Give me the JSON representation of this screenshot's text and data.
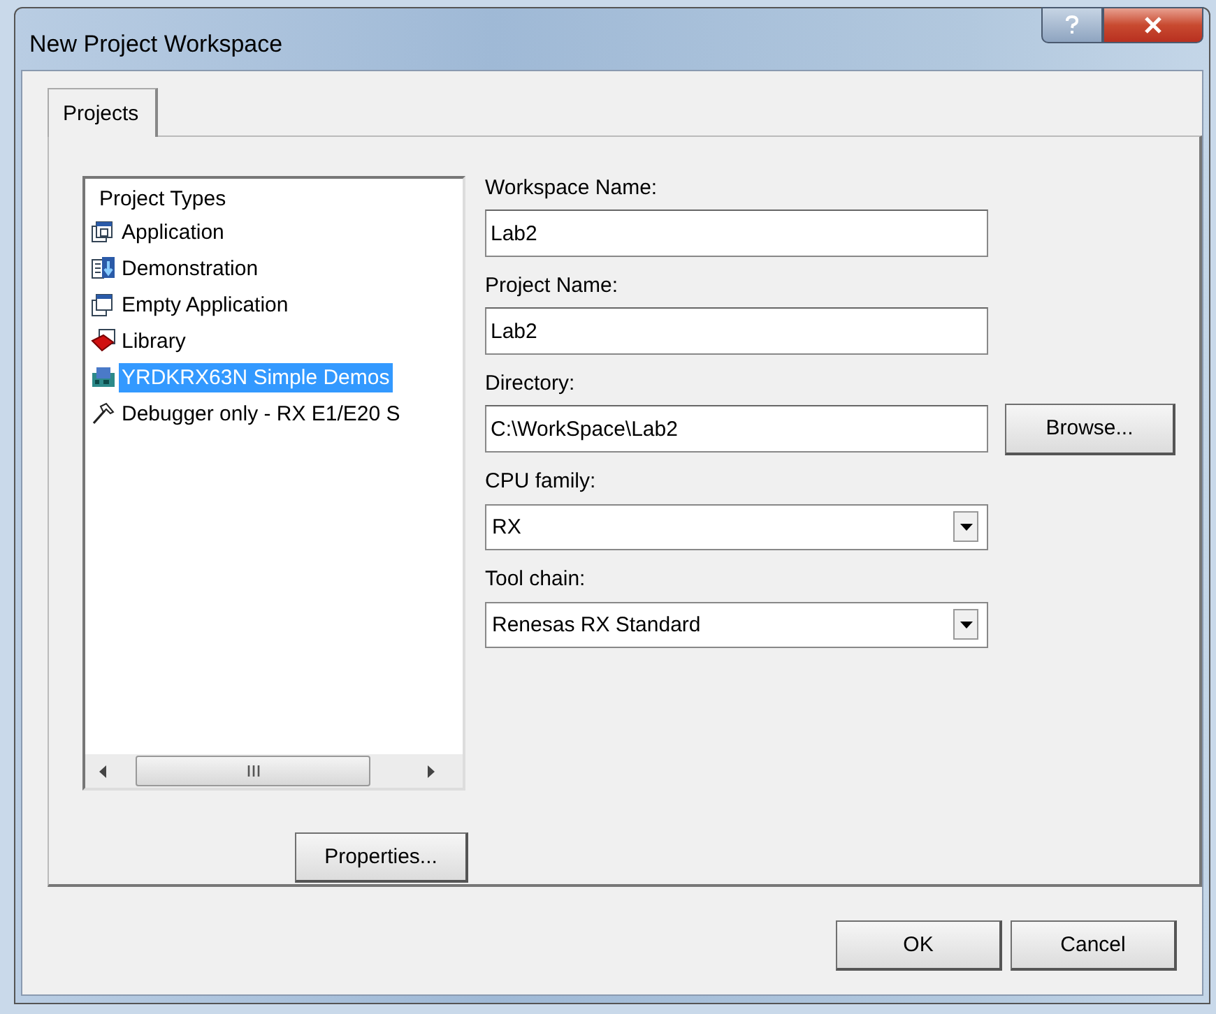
{
  "window": {
    "title": "New Project Workspace"
  },
  "tabs": [
    {
      "label": "Projects",
      "selected": true
    }
  ],
  "project_types": {
    "header": "Project Types",
    "items": [
      {
        "label": "Application",
        "selected": false
      },
      {
        "label": "Demonstration",
        "selected": false
      },
      {
        "label": "Empty Application",
        "selected": false
      },
      {
        "label": "Library",
        "selected": false
      },
      {
        "label": "YRDKRX63N Simple Demos",
        "selected": true
      },
      {
        "label": "Debugger only - RX E1/E20 S",
        "selected": false
      }
    ]
  },
  "properties_button": "Properties...",
  "fields": [
    {
      "kind": "text",
      "label": "Workspace Name:",
      "value": "Lab2"
    },
    {
      "kind": "text",
      "label": "Project Name:",
      "value": "Lab2"
    },
    {
      "kind": "browse",
      "label": "Directory:",
      "value": "C:\\WorkSpace\\Lab2",
      "button": "Browse..."
    },
    {
      "kind": "combo",
      "label": "CPU family:",
      "value": "RX"
    },
    {
      "kind": "combo",
      "label": "Tool chain:",
      "value": "Renesas RX Standard"
    }
  ],
  "buttons": [
    "OK",
    "Cancel"
  ]
}
